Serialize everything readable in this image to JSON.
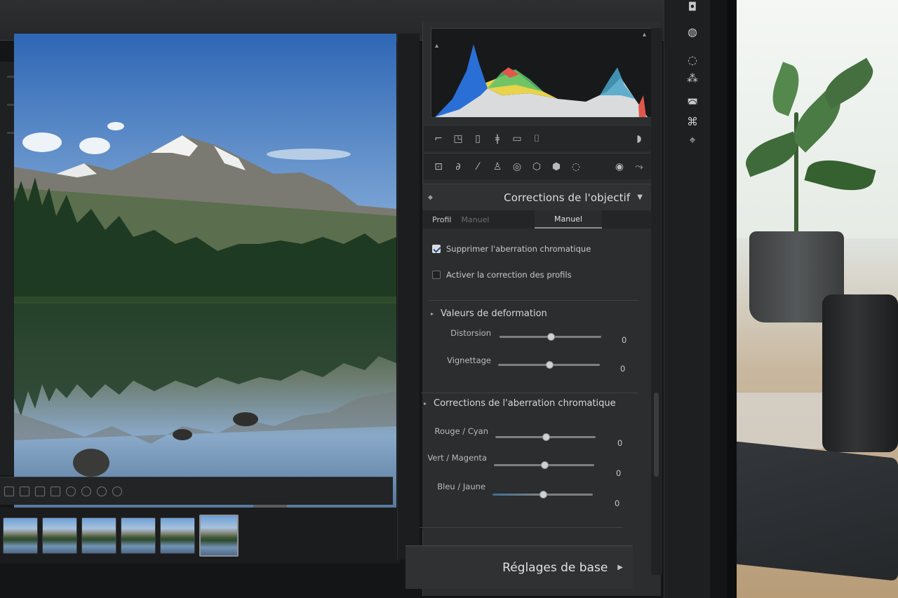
{
  "histogram": {
    "colors": {
      "blue": "#2a6fd6",
      "green": "#5cc16b",
      "yellow": "#e8d34a",
      "red": "#e2574b",
      "white": "#d9dbdd"
    }
  },
  "tools_row1": {
    "icons": [
      "crop-icon",
      "heal-icon",
      "mask-icon",
      "redeye-icon",
      "grad-icon",
      "brush-icon",
      "detail-toggle-icon"
    ]
  },
  "tools_row2": {
    "icons": [
      "frame-icon",
      "brush-tool-icon",
      "pen-icon",
      "people-icon",
      "filter-icon",
      "mask-a-icon",
      "mask-b-icon",
      "mask-c-icon",
      "circle-icon",
      "pin-icon"
    ]
  },
  "lens_panel": {
    "title": "Corrections de l'objectif",
    "tabs": {
      "profile": "Profil",
      "manual_dim": "Manuel",
      "manual": "Manuel"
    },
    "checkboxes": [
      {
        "label": "Supprimer l'aberration chromatique",
        "checked": true
      },
      {
        "label": "Activer la correction des profils",
        "checked": false
      }
    ],
    "distortion_group": {
      "title": "Valeurs de deformation",
      "sliders": [
        {
          "label": "Distorsion",
          "value": "0",
          "position": 0.5
        },
        {
          "label": "Vignettage",
          "value": "0",
          "position": 0.5
        }
      ]
    },
    "ca_group": {
      "title": "Corrections de l'aberration chromatique",
      "sliders": [
        {
          "label": "Rouge / Cyan",
          "value": "0",
          "position": 0.5
        },
        {
          "label": "Vert / Magenta",
          "value": "0",
          "position": 0.5
        },
        {
          "label": "Bleu / Jaune",
          "value": "0",
          "position": 0.5
        }
      ]
    }
  },
  "footer_panel": {
    "title": "Réglages de base"
  },
  "accent": "#2b4f86"
}
